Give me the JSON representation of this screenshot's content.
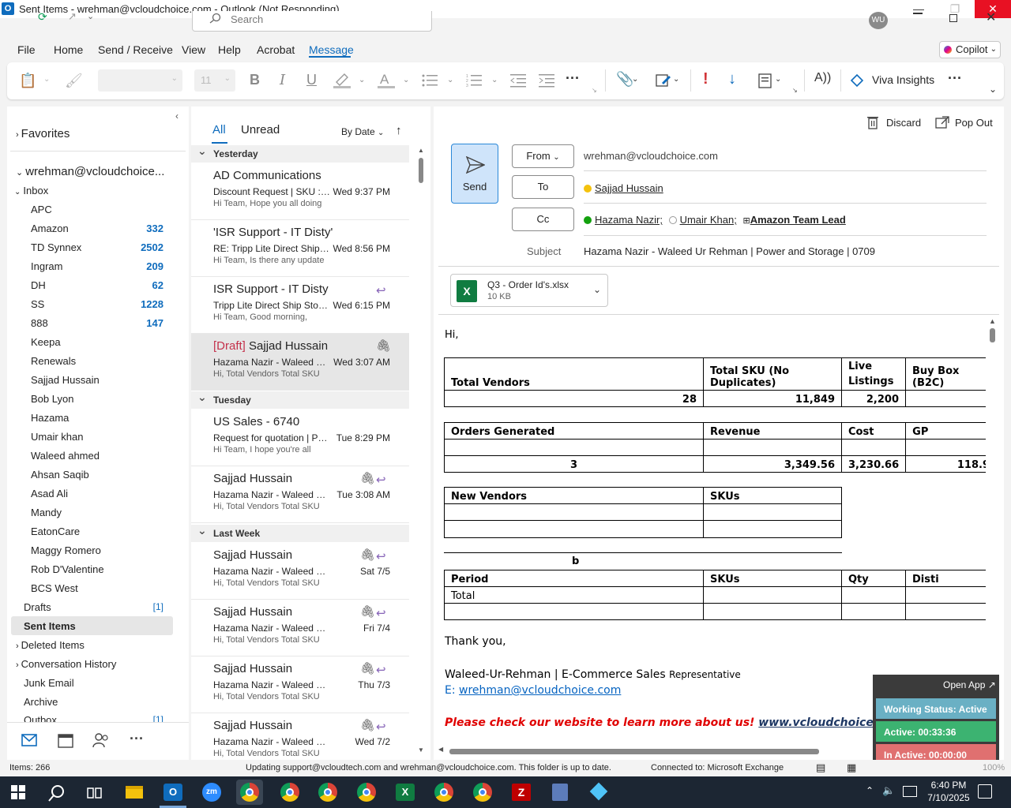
{
  "window": {
    "title": "Sent Items - wrehman@vcloudchoice.com - Outlook (Not Responding)",
    "app_icon": "O",
    "avatar": "WU"
  },
  "search": {
    "placeholder": "Search"
  },
  "menu": {
    "tabs": [
      "File",
      "Home",
      "Send / Receive",
      "View",
      "Help",
      "Acrobat",
      "Message"
    ],
    "active": "Message",
    "copilot": "Copilot"
  },
  "ribbon": {
    "font_size": "11",
    "viva": "Viva Insights"
  },
  "folders": {
    "favorites": "Favorites",
    "account": "wrehman@vcloudchoice...",
    "inbox": "Inbox",
    "subfolders": [
      {
        "name": "APC",
        "count": ""
      },
      {
        "name": "Amazon",
        "count": "332"
      },
      {
        "name": "TD Synnex",
        "count": "2502"
      },
      {
        "name": "Ingram",
        "count": "209"
      },
      {
        "name": "DH",
        "count": "62"
      },
      {
        "name": "SS",
        "count": "1228"
      },
      {
        "name": "888",
        "count": "147"
      },
      {
        "name": "Keepa",
        "count": ""
      },
      {
        "name": "Renewals",
        "count": ""
      },
      {
        "name": "Sajjad Hussain",
        "count": ""
      },
      {
        "name": "Bob Lyon",
        "count": ""
      },
      {
        "name": "Hazama",
        "count": ""
      },
      {
        "name": "Umair khan",
        "count": ""
      },
      {
        "name": "Waleed ahmed",
        "count": ""
      },
      {
        "name": "Ahsan Saqib",
        "count": ""
      },
      {
        "name": "Asad Ali",
        "count": ""
      },
      {
        "name": "Mandy",
        "count": ""
      },
      {
        "name": "EatonCare",
        "count": ""
      },
      {
        "name": "Maggy Romero",
        "count": ""
      },
      {
        "name": "Rob D'Valentine",
        "count": ""
      },
      {
        "name": "BCS West",
        "count": ""
      }
    ],
    "drafts": "Drafts",
    "drafts_count": "[1]",
    "sent": "Sent Items",
    "deleted": "Deleted Items",
    "conv": "Conversation History",
    "junk": "Junk Email",
    "archive": "Archive",
    "outbox": "Outbox",
    "outbox_count": "[1]"
  },
  "list": {
    "tab_all": "All",
    "tab_unread": "Unread",
    "sort": "By Date",
    "groups": {
      "yesterday": "Yesterday",
      "tuesday": "Tuesday",
      "lastweek": "Last Week"
    },
    "items": [
      {
        "sender": "AD Communications",
        "subject": "Discount Request | SKU : N...",
        "date": "Wed 9:37 PM",
        "preview": "Hi Team,  Hope you all doing"
      },
      {
        "sender": "'ISR Support - IT Disty'",
        "subject": "RE: Tripp Lite Direct Ship St...",
        "date": "Wed 8:56 PM",
        "preview": "Hi Team,  Is there any update"
      },
      {
        "sender": "ISR Support - IT Disty",
        "subject": "Tripp Lite Direct Ship Stock...",
        "date": "Wed 6:15 PM",
        "preview": "Hi Team,  Good morning,"
      },
      {
        "draft": "[Draft]",
        "sender": "Sajjad Hussain",
        "subject": "Hazama Nazir - Waleed Ur ...",
        "date": "Wed 3:07 AM",
        "preview": "Hi,  Total Vendors  Total SKU"
      },
      {
        "sender": "US Sales - 6740",
        "subject": "Request for quotation | Par...",
        "date": "Tue 8:29 PM",
        "preview": "Hi Team,  I hope you're all"
      },
      {
        "sender": "Sajjad Hussain",
        "subject": "Hazama Nazir - Waleed Ur ...",
        "date": "Tue 3:08 AM",
        "preview": "Hi,  Total Vendors  Total SKU"
      },
      {
        "sender": "Sajjad Hussain",
        "subject": "Hazama Nazir - Waleed Ur ...",
        "date": "Sat 7/5",
        "preview": "Hi,  Total Vendors  Total SKU"
      },
      {
        "sender": "Sajjad Hussain",
        "subject": "Hazama Nazir - Waleed Ur ...",
        "date": "Fri 7/4",
        "preview": "Hi,  Total Vendors  Total SKU"
      },
      {
        "sender": "Sajjad Hussain",
        "subject": "Hazama Nazir - Waleed Ur ...",
        "date": "Thu 7/3",
        "preview": "Hi,  Total Vendors  Total SKU"
      },
      {
        "sender": "Sajjad Hussain",
        "subject": "Hazama Nazir - Waleed Ur ...",
        "date": "Wed 7/2",
        "preview": "Hi,  Total Vendors  Total SKU"
      }
    ]
  },
  "compose": {
    "discard": "Discard",
    "popout": "Pop Out",
    "send": "Send",
    "from_label": "From",
    "from": "wrehman@vcloudchoice.com",
    "to_label": "To",
    "to": "Sajjad Hussain",
    "cc_label": "Cc",
    "cc1": "Hazama Nazir;",
    "cc2": "Umair Khan;",
    "cc3": "Amazon Team Lead",
    "subject_label": "Subject",
    "subject": "Hazama Nazir - Waleed Ur Rehman | Power and Storage | 0709",
    "attachment": {
      "name": "Q3 - Order Id's.xlsx",
      "size": "10 KB"
    }
  },
  "body": {
    "greeting": "Hi,",
    "t1": {
      "h": [
        "Total Vendors",
        "Total SKU (No Duplicates)",
        "Live Listings",
        "Buy Box (B2C)"
      ],
      "v": [
        "28",
        "11,849",
        "2,200",
        ""
      ]
    },
    "t2": {
      "h": [
        "Orders Generated",
        "Revenue",
        "Cost",
        "GP"
      ],
      "v": [
        "3",
        "3,349.56",
        "3,230.66",
        "118.9"
      ]
    },
    "t3": {
      "h": [
        "New Vendors",
        "SKUs"
      ]
    },
    "t4": {
      "caption": "b",
      "h": [
        "Period",
        "SKUs",
        "Qty",
        "Disti"
      ],
      "total": "Total"
    },
    "thanks": "Thank you,",
    "sig_name": "Waleed-Ur-Rehman | E-Commerce Sales ",
    "sig_role": "Representative",
    "sig_email_label": "E: ",
    "sig_email": "wrehman@vcloudchoice.com",
    "promo": "Please check our website to learn more about us! ",
    "promo_link": "www.vcloudchoice.com"
  },
  "widget": {
    "open": "Open App ↗",
    "status": "Working Status: Active",
    "active": "Active: 00:33:36",
    "inactive": "In Active: 00:00:00"
  },
  "status": {
    "items": "Items: 266",
    "updating": "Updating support@vcloudtech.com and wrehman@vcloudchoice.com.  This folder is up to date.",
    "connected": "Connected to: Microsoft Exchange",
    "zoom": "100%"
  },
  "taskbar": {
    "time": "6:40 PM",
    "date": "7/10/2025"
  },
  "colors": {
    "accent": "#0f6cbd",
    "draft": "#c4314b",
    "link": "#0563c1",
    "promo": "#e00000",
    "widget_green": "#3cb371",
    "widget_teal": "#6ab0c4",
    "widget_red": "#e07070"
  }
}
